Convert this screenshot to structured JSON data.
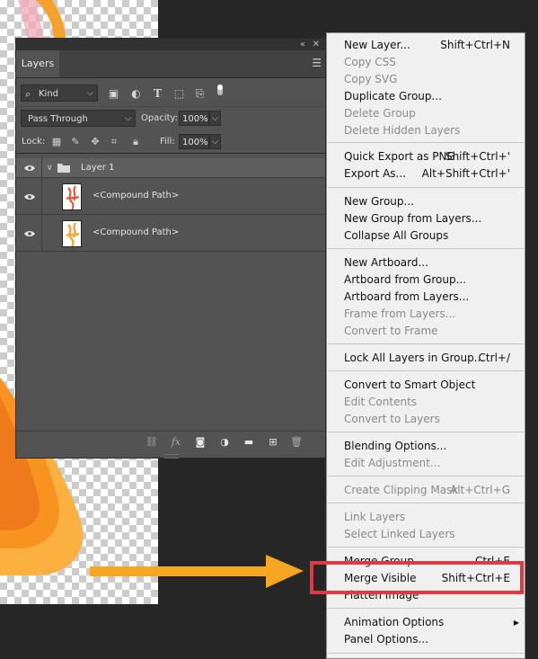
{
  "layers_panel": {
    "collapse_label": "«",
    "close_label": "✕",
    "tab_label": "Layers",
    "menu_icon": "panel-menu-icon",
    "filter": {
      "kind_label": "Kind",
      "icons": [
        "image-filter-icon",
        "adjustment-filter-icon",
        "type-filter-icon",
        "shape-filter-icon",
        "smart-object-filter-icon"
      ]
    },
    "blend_mode": "Pass Through",
    "opacity_label": "Opacity:",
    "opacity_value": "100%",
    "lock_label": "Lock:",
    "fill_label": "Fill:",
    "fill_value": "100%",
    "layers": [
      {
        "name": "Layer 1",
        "type": "group",
        "visible": true
      },
      {
        "name": "<Compound Path>",
        "type": "layer",
        "visible": true
      },
      {
        "name": "<Compound Path>",
        "type": "layer",
        "visible": true
      }
    ],
    "footer_icons": [
      "link-icon",
      "fx-icon",
      "mask-icon",
      "adjustment-icon",
      "folder-icon",
      "new-layer-icon",
      "trash-icon"
    ]
  },
  "context_menu": {
    "items": [
      {
        "label": "New Layer...",
        "shortcut": "Shift+Ctrl+N",
        "enabled": true
      },
      {
        "label": "Copy CSS",
        "shortcut": "",
        "enabled": false
      },
      {
        "label": "Copy SVG",
        "shortcut": "",
        "enabled": false
      },
      {
        "label": "Duplicate Group...",
        "shortcut": "",
        "enabled": true
      },
      {
        "label": "Delete Group",
        "shortcut": "",
        "enabled": false
      },
      {
        "label": "Delete Hidden Layers",
        "shortcut": "",
        "enabled": false
      },
      {
        "label": "Quick Export as PNG",
        "shortcut": "Shift+Ctrl+'",
        "enabled": true
      },
      {
        "label": "Export As...",
        "shortcut": "Alt+Shift+Ctrl+'",
        "enabled": true
      },
      {
        "label": "New Group...",
        "shortcut": "",
        "enabled": true
      },
      {
        "label": "New Group from Layers...",
        "shortcut": "",
        "enabled": true
      },
      {
        "label": "Collapse All Groups",
        "shortcut": "",
        "enabled": true
      },
      {
        "label": "New Artboard...",
        "shortcut": "",
        "enabled": true
      },
      {
        "label": "Artboard from Group...",
        "shortcut": "",
        "enabled": true
      },
      {
        "label": "Artboard from Layers...",
        "shortcut": "",
        "enabled": true
      },
      {
        "label": "Frame from Layers...",
        "shortcut": "",
        "enabled": false
      },
      {
        "label": "Convert to Frame",
        "shortcut": "",
        "enabled": false
      },
      {
        "label": "Lock All Layers in Group...",
        "shortcut": "Ctrl+/",
        "enabled": true
      },
      {
        "label": "Convert to Smart Object",
        "shortcut": "",
        "enabled": true
      },
      {
        "label": "Edit Contents",
        "shortcut": "",
        "enabled": false
      },
      {
        "label": "Convert to Layers",
        "shortcut": "",
        "enabled": false
      },
      {
        "label": "Blending Options...",
        "shortcut": "",
        "enabled": true
      },
      {
        "label": "Edit Adjustment...",
        "shortcut": "",
        "enabled": false
      },
      {
        "label": "Create Clipping Mask",
        "shortcut": "Alt+Ctrl+G",
        "enabled": false
      },
      {
        "label": "Link Layers",
        "shortcut": "",
        "enabled": false
      },
      {
        "label": "Select Linked Layers",
        "shortcut": "",
        "enabled": false
      },
      {
        "label": "Merge Group",
        "shortcut": "Ctrl+E",
        "enabled": true
      },
      {
        "label": "Merge Visible",
        "shortcut": "Shift+Ctrl+E",
        "enabled": true,
        "highlighted": true
      },
      {
        "label": "Flatten Image",
        "shortcut": "",
        "enabled": true
      },
      {
        "label": "Animation Options",
        "shortcut": "",
        "enabled": true,
        "submenu": true
      },
      {
        "label": "Panel Options...",
        "shortcut": "",
        "enabled": true
      }
    ]
  },
  "annotation": {
    "arrow_color": "#f5a623",
    "highlight_color": "#e4373f",
    "target_item": "Merge Visible"
  }
}
